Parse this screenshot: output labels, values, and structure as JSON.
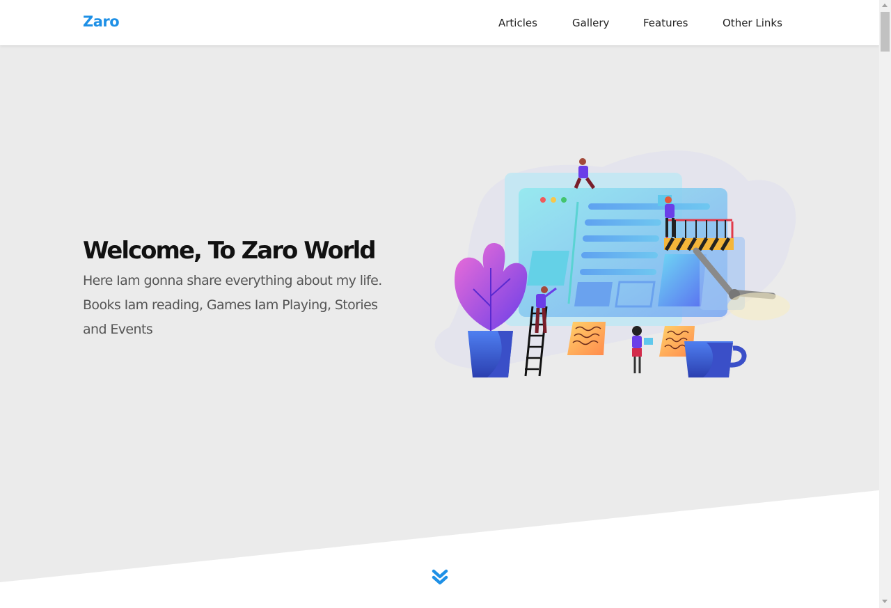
{
  "header": {
    "logo": "Zaro",
    "nav": [
      "Articles",
      "Gallery",
      "Features",
      "Other Links"
    ]
  },
  "hero": {
    "title": "Welcome, To Zaro World",
    "description": "Here Iam gonna share everything about my life. Books Iam reading, Games Iam Playing, Stories and Events",
    "illustration": "team-building-website-illustration"
  },
  "icons": {
    "scroll_down": "double-chevron-down-icon"
  },
  "colors": {
    "accent": "#1e90e6",
    "hero_background": "#ebebeb",
    "title": "#111111",
    "body_text": "#555555"
  }
}
